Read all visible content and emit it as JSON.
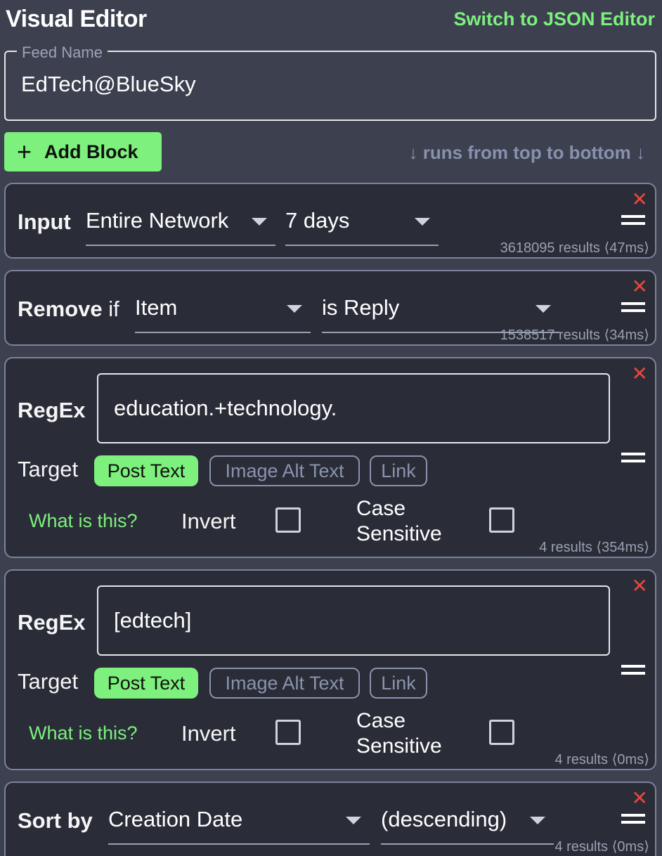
{
  "header": {
    "title": "Visual Editor",
    "switch_label": "Switch to JSON Editor"
  },
  "feed_name": {
    "legend": "Feed Name",
    "value": "EdTech@BlueSky"
  },
  "toolbar": {
    "add_icon": "+",
    "add_label": "Add Block",
    "order_hint": "↓ runs from top to bottom ↓"
  },
  "icons": {
    "close": "✕",
    "drag": "drag-handle-icon",
    "caret": "chevron-down-icon"
  },
  "colors": {
    "accent": "#7df07d",
    "close": "#e8473a",
    "background": "#3c404f",
    "block": "#2a2d38"
  },
  "blocks": {
    "input": {
      "label": "Input",
      "source": "Entire Network",
      "range": "7 days",
      "results": "3618095 results ⟨47ms⟩"
    },
    "remove": {
      "label": "Remove",
      "conj": "if",
      "subject": "Item",
      "condition": "is Reply",
      "results": "1538517 results ⟨34ms⟩"
    },
    "regex1": {
      "label": "RegEx",
      "pattern": "education.+technology.",
      "target_label": "Target",
      "chips": [
        "Post Text",
        "Image Alt Text",
        "Link"
      ],
      "active_chip": "Post Text",
      "help": "What is this?",
      "invert_label": "Invert",
      "invert_checked": false,
      "case_line1": "Case",
      "case_line2": "Sensitive",
      "case_checked": false,
      "results": "4 results ⟨354ms⟩"
    },
    "regex2": {
      "label": "RegEx",
      "pattern": "[edtech]",
      "target_label": "Target",
      "chips": [
        "Post Text",
        "Image Alt Text",
        "Link"
      ],
      "active_chip": "Post Text",
      "help": "What is this?",
      "invert_label": "Invert",
      "invert_checked": false,
      "case_line1": "Case",
      "case_line2": "Sensitive",
      "case_checked": false,
      "results": "4 results ⟨0ms⟩"
    },
    "sort": {
      "label": "Sort by",
      "field": "Creation Date",
      "order": "(descending)",
      "results": "4 results ⟨0ms⟩"
    }
  }
}
